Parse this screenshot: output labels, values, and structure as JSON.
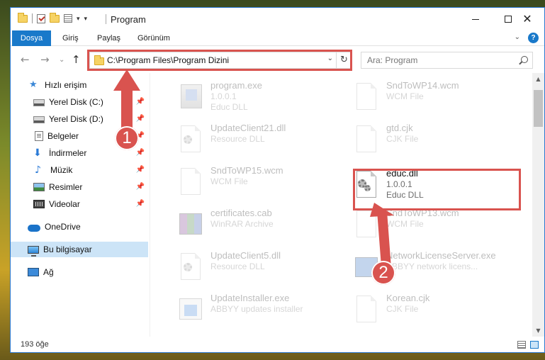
{
  "window": {
    "title": "Program"
  },
  "ribbon": {
    "tabs": [
      {
        "label": "Dosya"
      },
      {
        "label": "Giriş"
      },
      {
        "label": "Paylaş"
      },
      {
        "label": "Görünüm"
      }
    ],
    "help_label": "?"
  },
  "navigation": {
    "back_icon": "back-arrow-icon",
    "forward_icon": "forward-arrow-icon",
    "recent_icon": "chevron-down-icon",
    "up_icon": "up-arrow-icon",
    "address": "C:\\Program Files\\Program Dizini",
    "search_placeholder": "Ara: Program"
  },
  "sidebar": {
    "items": [
      {
        "label": "Hızlı erişim",
        "icon": "star-icon"
      },
      {
        "label": "Yerel Disk (C:)",
        "icon": "drive-icon",
        "pinned": true
      },
      {
        "label": "Yerel Disk (D:)",
        "icon": "drive-icon",
        "pinned": true
      },
      {
        "label": "Belgeler",
        "icon": "documents-icon",
        "pinned": true
      },
      {
        "label": "İndirmeler",
        "icon": "download-icon",
        "pinned": true
      },
      {
        "label": "Müzik",
        "icon": "music-icon",
        "pinned": true
      },
      {
        "label": "Resimler",
        "icon": "pictures-icon",
        "pinned": true
      },
      {
        "label": "Videolar",
        "icon": "videos-icon",
        "pinned": true
      },
      {
        "label": "OneDrive",
        "icon": "cloud-icon"
      },
      {
        "label": "Bu bilgisayar",
        "icon": "computer-icon",
        "selected": true
      },
      {
        "label": "Ağ",
        "icon": "network-icon"
      }
    ]
  },
  "files": [
    {
      "name": "program.exe",
      "line1": "1.0.0.1",
      "line2": "Educ DLL",
      "icon": "exe-icon",
      "faded": true
    },
    {
      "name": "SndToWP14.wcm",
      "line1": "WCM File",
      "line2": "",
      "icon": "page-icon",
      "faded": true
    },
    {
      "name": "UpdateClient21.dll",
      "line1": "Resource DLL",
      "line2": "",
      "icon": "dll-icon",
      "faded": true
    },
    {
      "name": "gtd.cjk",
      "line1": "CJK File",
      "line2": "",
      "icon": "page-icon",
      "faded": true
    },
    {
      "name": "SndToWP15.wcm",
      "line1": "WCM File",
      "line2": "",
      "icon": "page-icon",
      "faded": true
    },
    {
      "name": "educ.dll",
      "line1": "1.0.0.1",
      "line2": "Educ DLL",
      "icon": "dll-icon",
      "faded": false
    },
    {
      "name": "certificates.cab",
      "line1": "WinRAR Archive",
      "line2": "",
      "icon": "archive-icon",
      "faded": true
    },
    {
      "name": "SndToWP13.wcm",
      "line1": "WCM File",
      "line2": "",
      "icon": "page-icon",
      "faded": true
    },
    {
      "name": "UpdateClient5.dll",
      "line1": "Resource DLL",
      "line2": "",
      "icon": "dll-icon",
      "faded": true
    },
    {
      "name": "NetworkLicenseServer.exe",
      "line1": "ABBYY network licens...",
      "line2": "",
      "icon": "network-exe-icon",
      "faded": true
    },
    {
      "name": "UpdateInstaller.exe",
      "line1": "ABBYY updates installer",
      "line2": "",
      "icon": "installer-icon",
      "faded": true
    },
    {
      "name": "Korean.cjk",
      "line1": "CJK File",
      "line2": "",
      "icon": "page-icon",
      "faded": true
    }
  ],
  "status": {
    "item_count": "193 öğe"
  },
  "annotations": {
    "badge1": "1",
    "badge2": "2"
  },
  "colors": {
    "accent": "#1979ca",
    "highlight": "#d9534f",
    "selection": "#cce4f7"
  }
}
